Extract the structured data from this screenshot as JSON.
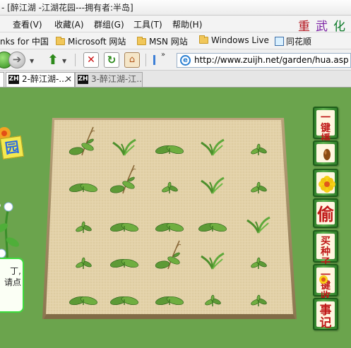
{
  "window": {
    "title": "- [醉江湖 -江湖花园---拥有者:半岛]"
  },
  "menu": {
    "items": [
      "查看(V)",
      "收藏(A)",
      "群组(G)",
      "工具(T)",
      "帮助(H)"
    ],
    "logo_chars": [
      "重",
      "武",
      "化"
    ]
  },
  "links": {
    "items": [
      "nks for 中国",
      "Microsoft 网站",
      "MSN 网站",
      "Windows Live",
      "同花顺"
    ]
  },
  "address": {
    "url": "http://www.zuijh.net/garden/hua.asp"
  },
  "tabs": {
    "active_label": "2-醉江湖-...",
    "inactive_label": "3-醉江湖-江...",
    "close_glyph": "✕",
    "icon_label": "ZH"
  },
  "game": {
    "side_buttons": [
      {
        "line1": "一键",
        "line2": "播种"
      },
      {
        "icon": "seed-icon"
      },
      {
        "icon": "flower-icon"
      },
      {
        "big": "偷"
      },
      {
        "line1": "买",
        "line2": "种子"
      },
      {
        "line1": "一键",
        "line2": "收花"
      },
      {
        "line1": "事",
        "line2": "记"
      }
    ],
    "left_text": [
      "丁,",
      "请点"
    ],
    "left_badge": "园"
  },
  "colors": {
    "grass": "#6aa44e",
    "soil": "#e3d2a9",
    "button_text": "#c01818"
  }
}
